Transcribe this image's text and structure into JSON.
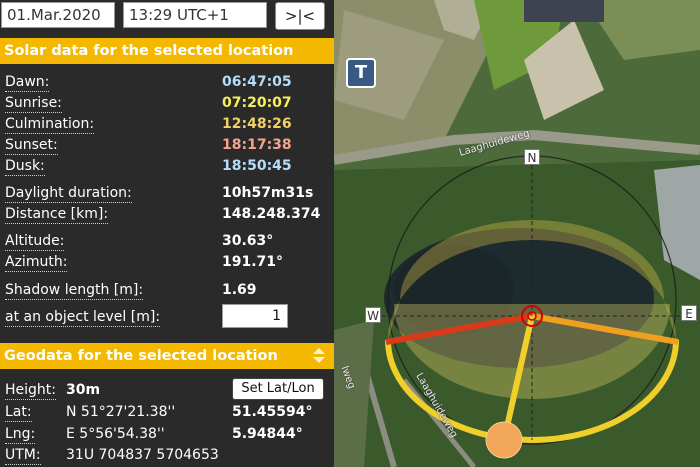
{
  "toolbar": {
    "date": "01.Mar.2020",
    "time": "13:29 UTC+1",
    "now_label": ">|<"
  },
  "solar": {
    "title": "Solar data for the selected location",
    "rows": [
      {
        "label": "Dawn:",
        "value": "06:47:05"
      },
      {
        "label": "Sunrise:",
        "value": "07:20:07"
      },
      {
        "label": "Culmination:",
        "value": "12:48:26"
      },
      {
        "label": "Sunset:",
        "value": "18:17:38"
      },
      {
        "label": "Dusk:",
        "value": "18:50:45"
      },
      {
        "label": "Daylight duration:",
        "value": "10h57m31s"
      },
      {
        "label": "Distance [km]:",
        "value": "148.248.374"
      },
      {
        "label": "Altitude:",
        "value": "30.63°"
      },
      {
        "label": "Azimuth:",
        "value": "191.71°"
      },
      {
        "label": "Shadow length [m]:",
        "value": "1.69"
      },
      {
        "label": "at an object level [m]:",
        "value": "1"
      }
    ],
    "colors": {
      "dawn": "#b6ddf5",
      "sunrise": "#f7ef5c",
      "culmination": "#f3d065",
      "sunset": "#f4a48a",
      "dusk": "#b6ddf5"
    }
  },
  "geo": {
    "title": "Geodata for the selected location",
    "height_label": "Height:",
    "height_value": "30m",
    "set_button": "Set Lat/Lon",
    "lat_label": "Lat:",
    "lat_dms": "N 51°27'21.38''",
    "lat_dec": "51.45594°",
    "lng_label": "Lng:",
    "lng_dms": "E 5°56'54.38''",
    "lng_dec": "5.94844°",
    "utm_label": "UTM:",
    "utm_value": "31U 704837 5704653"
  },
  "map": {
    "marker_label": "T",
    "compass": {
      "n": "N",
      "w": "W",
      "e": "E"
    },
    "road_top": "Laaghuideweg",
    "road_bottom": "Laaghuideweg",
    "road_left": "lweg"
  }
}
